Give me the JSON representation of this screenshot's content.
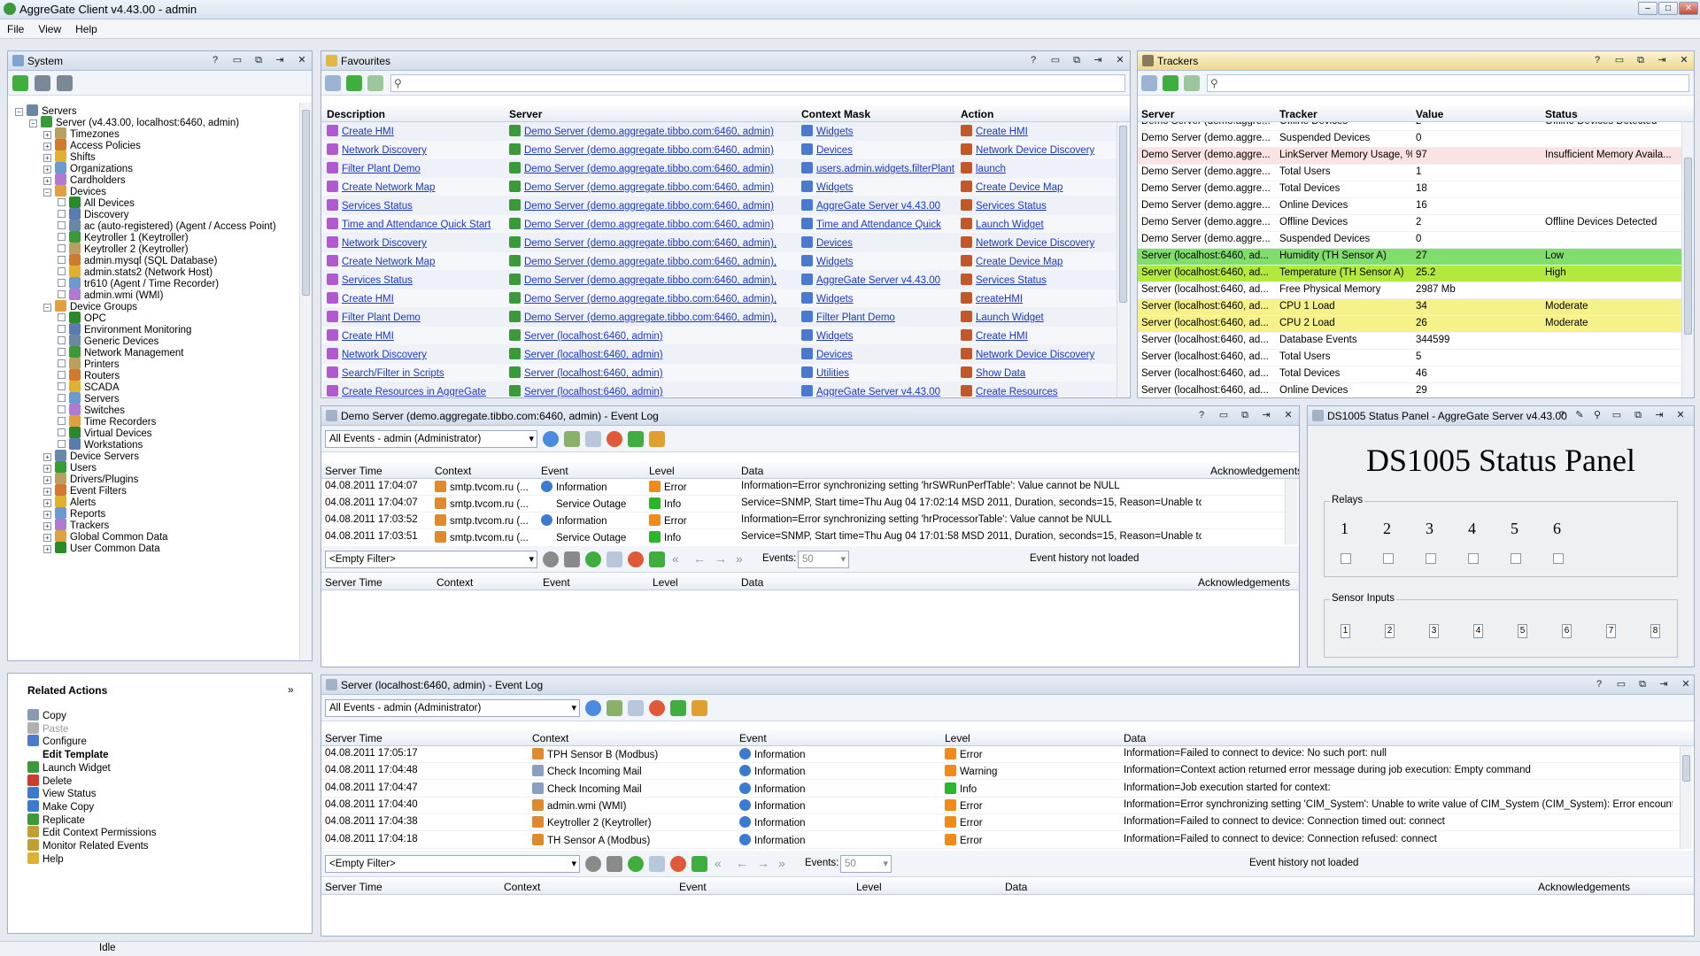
{
  "window": {
    "title": "AggreGate Client v4.43.00 - admin",
    "controls": [
      "–",
      "□",
      "✕"
    ]
  },
  "menu": [
    "File",
    "View",
    "Help"
  ],
  "system": {
    "title": "System",
    "tree": [
      {
        "label": "Servers",
        "l": 0
      },
      {
        "label": "Server (v4.43.00, localhost:6460, admin)",
        "l": 1
      },
      {
        "label": "Timezones",
        "l": 2
      },
      {
        "label": "Access Policies",
        "l": 2
      },
      {
        "label": "Shifts",
        "l": 2
      },
      {
        "label": "Organizations",
        "l": 2
      },
      {
        "label": "Cardholders",
        "l": 2
      },
      {
        "label": "Devices",
        "l": 2
      },
      {
        "label": "All Devices",
        "l": 3
      },
      {
        "label": "Discovery",
        "l": 3
      },
      {
        "label": "ac (auto-registered) (Agent / Access Point)",
        "l": 3
      },
      {
        "label": "Keytroller 1 (Keytroller)",
        "l": 3
      },
      {
        "label": "Keytroller 2 (Keytroller)",
        "l": 3
      },
      {
        "label": "admin.mysql (SQL Database)",
        "l": 3
      },
      {
        "label": "admin.stats2 (Network Host)",
        "l": 3
      },
      {
        "label": "tr610 (Agent / Time Recorder)",
        "l": 3
      },
      {
        "label": "admin.wmi (WMI)",
        "l": 3
      },
      {
        "label": "Device Groups",
        "l": 2
      },
      {
        "label": "OPC",
        "l": 3
      },
      {
        "label": "Environment Monitoring",
        "l": 3
      },
      {
        "label": "Generic Devices",
        "l": 3
      },
      {
        "label": "Network Management",
        "l": 3
      },
      {
        "label": "Printers",
        "l": 3
      },
      {
        "label": "Routers",
        "l": 3
      },
      {
        "label": "SCADA",
        "l": 3
      },
      {
        "label": "Servers",
        "l": 3
      },
      {
        "label": "Switches",
        "l": 3
      },
      {
        "label": "Time Recorders",
        "l": 3
      },
      {
        "label": "Virtual Devices",
        "l": 3
      },
      {
        "label": "Workstations",
        "l": 3
      },
      {
        "label": "Device Servers",
        "l": 2
      },
      {
        "label": "Users",
        "l": 2
      },
      {
        "label": "Drivers/Plugins",
        "l": 2
      },
      {
        "label": "Event Filters",
        "l": 2
      },
      {
        "label": "Alerts",
        "l": 2
      },
      {
        "label": "Reports",
        "l": 2
      },
      {
        "label": "Trackers",
        "l": 2
      },
      {
        "label": "Global Common Data",
        "l": 2
      },
      {
        "label": "User Common Data",
        "l": 2
      }
    ]
  },
  "related": {
    "title": "Related Actions",
    "items": [
      {
        "label": "Copy",
        "bold": false,
        "dis": false
      },
      {
        "label": "Paste",
        "bold": false,
        "dis": true
      },
      {
        "label": "Configure",
        "bold": false,
        "dis": false
      },
      {
        "label": "Edit Template",
        "bold": true,
        "dis": false
      },
      {
        "label": "Launch Widget",
        "bold": false,
        "dis": false
      },
      {
        "label": "Delete",
        "bold": false,
        "dis": false
      },
      {
        "label": "View Status",
        "bold": false,
        "dis": false
      },
      {
        "label": "Make Copy",
        "bold": false,
        "dis": false
      },
      {
        "label": "Replicate",
        "bold": false,
        "dis": false
      },
      {
        "label": "Edit Context Permissions",
        "bold": false,
        "dis": false
      },
      {
        "label": "Monitor Related Events",
        "bold": false,
        "dis": false
      },
      {
        "label": "Help",
        "bold": false,
        "dis": false
      }
    ]
  },
  "favourites": {
    "title": "Favourites",
    "cols": [
      "Description",
      "Server",
      "Context Mask",
      "Action"
    ],
    "rows": [
      [
        "Create HMI",
        "Demo Server (demo.aggregate.tibbo.com:6460, admin)",
        "Widgets",
        "Create HMI"
      ],
      [
        "Network Discovery",
        "Demo Server (demo.aggregate.tibbo.com:6460, admin)",
        "Devices",
        "Network Device Discovery"
      ],
      [
        "Filter Plant Demo",
        "Demo Server (demo.aggregate.tibbo.com:6460, admin)",
        "users.admin.widgets.filterPlant",
        "launch"
      ],
      [
        "Create Network Map",
        "Demo Server (demo.aggregate.tibbo.com:6460, admin)",
        "Widgets",
        "Create Device Map"
      ],
      [
        "Services Status",
        "Demo Server (demo.aggregate.tibbo.com:6460, admin)",
        "AggreGate Server v4.43.00",
        "Services Status"
      ],
      [
        "Time and Attendance Quick Start",
        "Demo Server (demo.aggregate.tibbo.com:6460, admin)",
        "Time and Attendance Quick",
        "Launch Widget"
      ],
      [
        "Network Discovery",
        "Demo Server (demo.aggregate.tibbo.com:6460, admin),",
        "Devices",
        "Network Device Discovery"
      ],
      [
        "Create Network Map",
        "Demo Server (demo.aggregate.tibbo.com:6460, admin),",
        "Widgets",
        "Create Device Map"
      ],
      [
        "Services Status",
        "Demo Server (demo.aggregate.tibbo.com:6460, admin),",
        "AggreGate Server v4.43.00",
        "Services Status"
      ],
      [
        "Create HMI",
        "Demo Server (demo.aggregate.tibbo.com:6460, admin),",
        "Widgets",
        "createHMI"
      ],
      [
        "Filter Plant Demo",
        "Demo Server (demo.aggregate.tibbo.com:6460, admin),",
        "Filter Plant Demo",
        "Launch Widget"
      ],
      [
        "Create HMI",
        "Server (localhost:6460, admin)",
        "Widgets",
        "Create HMI"
      ],
      [
        "Network Discovery",
        "Server (localhost:6460, admin)",
        "Devices",
        "Network Device Discovery"
      ],
      [
        "Search/Filter in Scripts",
        "Server (localhost:6460, admin)",
        "Utilities",
        "Show Data"
      ],
      [
        "Create Resources in AggreGate",
        "Server (localhost:6460, admin)",
        "AggreGate Server v4.43.00",
        "Create Resources"
      ]
    ]
  },
  "trackers": {
    "title": "Trackers",
    "cols": [
      "Server",
      "Tracker",
      "Value",
      "Status"
    ],
    "rows": [
      [
        "Demo Server (demo.aggre...",
        "Offline Devices",
        "2",
        "Offline Devices Detected",
        ""
      ],
      [
        "Demo Server (demo.aggre...",
        "Suspended Devices",
        "0",
        "",
        ""
      ],
      [
        "Demo Server (demo.aggre...",
        "LinkServer Memory Usage, %",
        "97",
        "Insufficient Memory Availa...",
        "#fbe3e3"
      ],
      [
        "Demo Server (demo.aggre...",
        "Total Users",
        "1",
        "",
        ""
      ],
      [
        "Demo Server (demo.aggre...",
        "Total Devices",
        "18",
        "",
        ""
      ],
      [
        "Demo Server (demo.aggre...",
        "Online Devices",
        "16",
        "",
        ""
      ],
      [
        "Demo Server (demo.aggre...",
        "Offline Devices",
        "2",
        "Offline Devices Detected",
        ""
      ],
      [
        "Demo Server (demo.aggre...",
        "Suspended Devices",
        "0",
        "",
        ""
      ],
      [
        "Server (localhost:6460, ad...",
        "Humidity (TH Sensor A)",
        "27",
        "Low",
        "#7fdf6a"
      ],
      [
        "Server (localhost:6460, ad...",
        "Temperature (TH Sensor A)",
        "25.2",
        "High",
        "#b3e83f"
      ],
      [
        "Server (localhost:6460, ad...",
        "Free Physical Memory",
        "2987 Mb",
        "",
        ""
      ],
      [
        "Server (localhost:6460, ad...",
        "CPU 1 Load",
        "34",
        "Moderate",
        "#f5f28a"
      ],
      [
        "Server (localhost:6460, ad...",
        "CPU 2 Load",
        "26",
        "Moderate",
        "#f5f28a"
      ],
      [
        "Server (localhost:6460, ad...",
        "Database Events",
        "344599",
        "",
        ""
      ],
      [
        "Server (localhost:6460, ad...",
        "Total Users",
        "5",
        "",
        ""
      ],
      [
        "Server (localhost:6460, ad...",
        "Total Devices",
        "46",
        "",
        ""
      ],
      [
        "Server (localhost:6460, ad...",
        "Online Devices",
        "29",
        "",
        ""
      ]
    ]
  },
  "demoLog": {
    "title": "Demo Server (demo.aggregate.tibbo.com:6460, admin) - Event Log",
    "filter": "All Events - admin (Administrator)",
    "cols": [
      "Server Time",
      "Context",
      "Event",
      "Level",
      "Data",
      "Acknowledgements"
    ],
    "rows": [
      [
        "04.08.2011 17:04:07",
        "smtp.tvcom.ru (...",
        "Information",
        "Error",
        "Information=Error synchronizing setting 'hrSWRunPerfTable': Value cannot be NULL"
      ],
      [
        "04.08.2011 17:04:07",
        "smtp.tvcom.ru (...",
        "Service Outage",
        "Info",
        "Service=SNMP, Start time=Thu Aug 04 17:02:14 MSD 2011, Duration, seconds=15, Reason=Unable to ..."
      ],
      [
        "04.08.2011 17:03:52",
        "smtp.tvcom.ru (...",
        "Information",
        "Error",
        "Information=Error synchronizing setting 'hrProcessorTable': Value cannot be NULL"
      ],
      [
        "04.08.2011 17:03:51",
        "smtp.tvcom.ru (...",
        "Service Outage",
        "Info",
        "Service=SNMP, Start time=Thu Aug 04 17:01:58 MSD 2011, Duration, seconds=15, Reason=Unable to ..."
      ]
    ],
    "hfilter": "<Empty Filter>",
    "eventsLabel": "Events:",
    "eventsVal": "50",
    "notLoaded": "Event history not loaded"
  },
  "status": {
    "title": "DS1005 Status Panel - AggreGate Server v4.43.00",
    "heading": "DS1005 Status Panel",
    "relays": "Relays",
    "relayNums": [
      "1",
      "2",
      "3",
      "4",
      "5",
      "6"
    ],
    "sensors": "Sensor Inputs",
    "sensorNums": [
      "1",
      "2",
      "3",
      "4",
      "5",
      "6",
      "7",
      "8"
    ]
  },
  "localLog": {
    "title": "Server (localhost:6460, admin) - Event Log",
    "filter": "All Events - admin (Administrator)",
    "cols": [
      "Server Time",
      "Context",
      "Event",
      "Level",
      "Data"
    ],
    "rows": [
      [
        "04.08.2011 17:05:17",
        "TPH Sensor B (Modbus)",
        "Information",
        "Error",
        "Information=Failed to connect to device: No such port: null"
      ],
      [
        "04.08.2011 17:04:48",
        "Check Incoming Mail",
        "Information",
        "Warning",
        "Information=Context action returned error message during job execution: Empty command"
      ],
      [
        "04.08.2011 17:04:47",
        "Check Incoming Mail",
        "Information",
        "Info",
        "Information=Job execution started for context:"
      ],
      [
        "04.08.2011 17:04:40",
        "admin.wmi (WMI)",
        "Information",
        "Error",
        "Information=Error synchronizing setting 'CIM_System': Unable to write value of CIM_System (CIM_System): Error encountere..."
      ],
      [
        "04.08.2011 17:04:38",
        "Keytroller 2 (Keytroller)",
        "Information",
        "Error",
        "Information=Failed to connect to device: Connection timed out: connect"
      ],
      [
        "04.08.2011 17:04:18",
        "TH Sensor A (Modbus)",
        "Information",
        "Error",
        "Information=Failed to connect to device: Connection refused: connect"
      ]
    ],
    "hcols": [
      "Server Time",
      "Context",
      "Event",
      "Level",
      "Data",
      "Acknowledgements"
    ]
  },
  "statusbar": "Idle",
  "colors": {
    "Error": "#f08a1a",
    "Info": "#2bb52b",
    "Warning": "#f08a1a"
  }
}
